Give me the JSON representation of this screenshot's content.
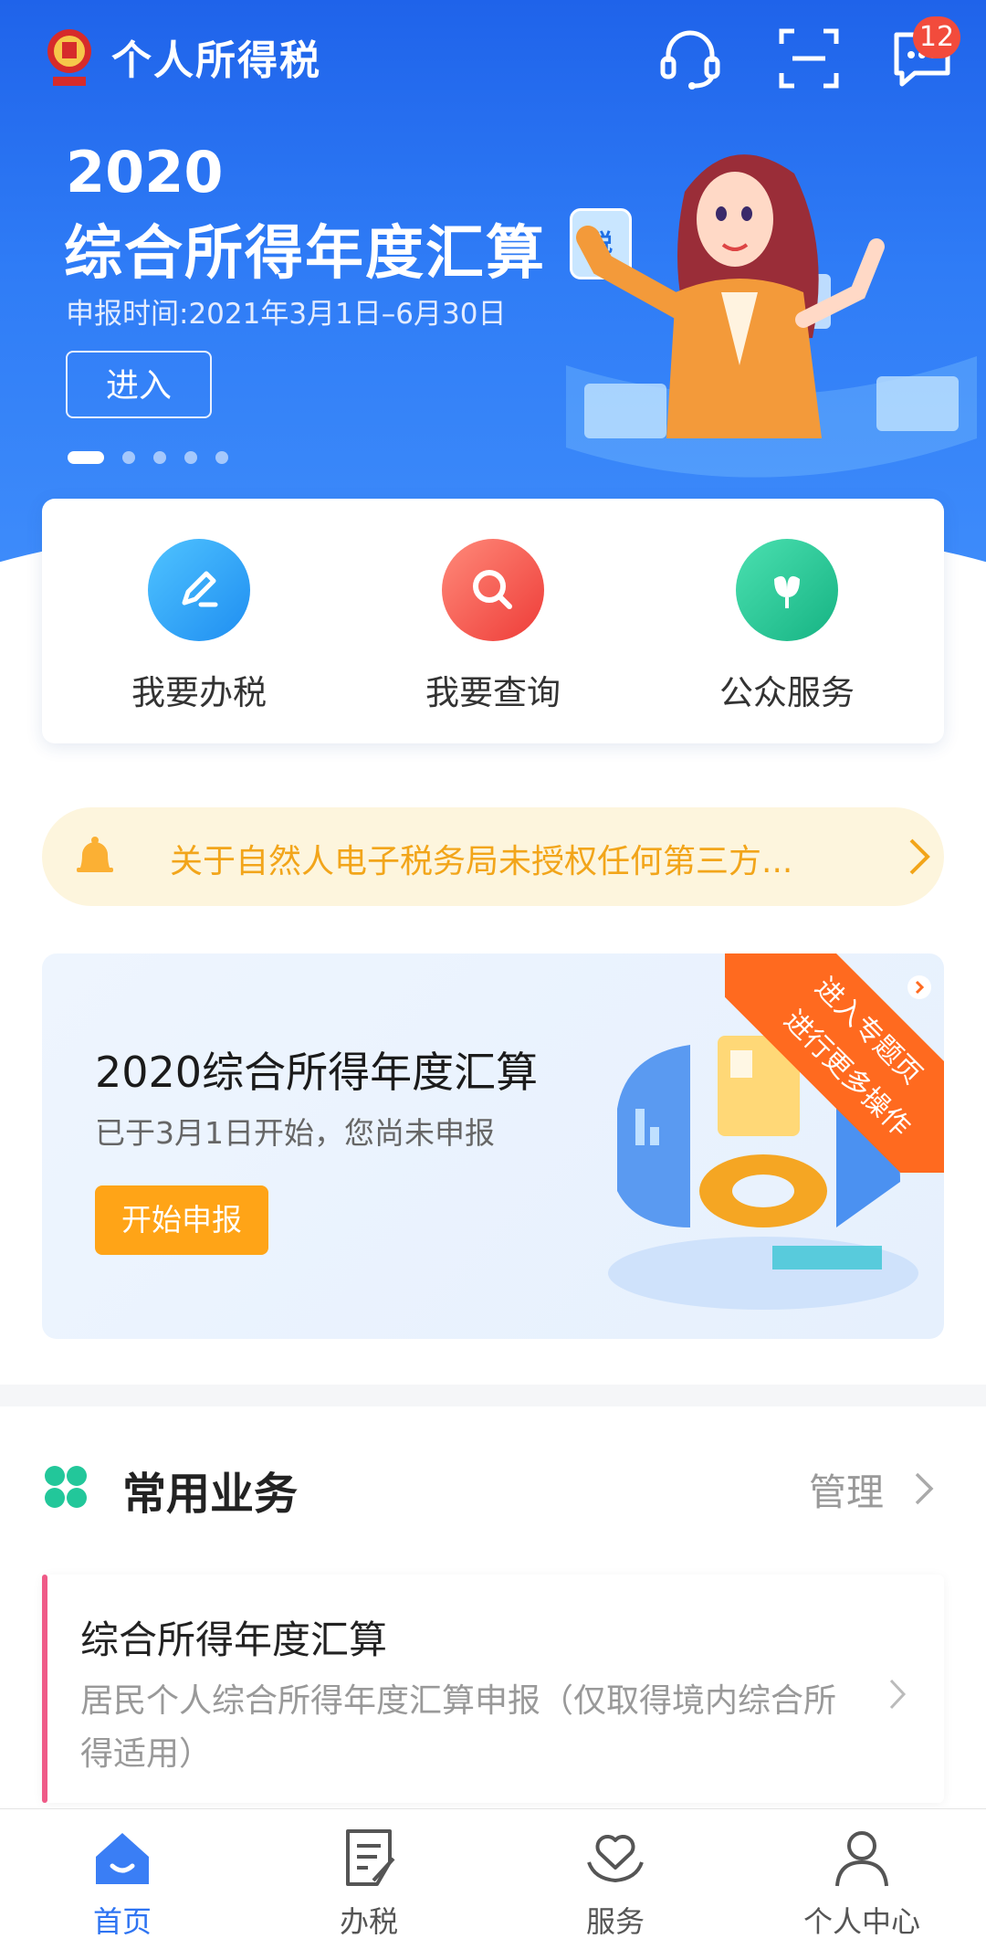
{
  "header": {
    "app_title": "个人所得税",
    "message_count": "12",
    "icons": [
      "customer-service-icon",
      "scan-icon",
      "message-icon"
    ]
  },
  "banner": {
    "year": "2020",
    "title": "综合所得年度汇算",
    "subtitle": "申报时间:2021年3月1日–6月30日",
    "enter_label": "进入",
    "tax_tag": "税",
    "slides": 5,
    "active_slide": 1
  },
  "quick_actions": [
    {
      "label": "我要办税",
      "icon": "edit-icon",
      "color": "#27a7f7"
    },
    {
      "label": "我要查询",
      "icon": "search-icon",
      "color": "#f2544a"
    },
    {
      "label": "公众服务",
      "icon": "tulip-icon",
      "color": "#22c28e"
    }
  ],
  "notice": {
    "text": "关于自然人电子税务局未授权任何第三方..."
  },
  "promo": {
    "title": "2020综合所得年度汇算",
    "subtitle": "已于3月1日开始，您尚未申报",
    "button_label": "开始申报",
    "ribbon_line1": "进入专题页",
    "ribbon_line2": "进行更多操作"
  },
  "common": {
    "title": "常用业务",
    "manage_label": "管理",
    "items": [
      {
        "title": "综合所得年度汇算",
        "description": "居民个人综合所得年度汇算申报（仅取得境内综合所得适用）"
      }
    ]
  },
  "tabs": [
    {
      "label": "首页",
      "icon": "home-icon",
      "active": true
    },
    {
      "label": "办税",
      "icon": "document-edit-icon",
      "active": false
    },
    {
      "label": "服务",
      "icon": "heart-hands-icon",
      "active": false
    },
    {
      "label": "个人中心",
      "icon": "user-icon",
      "active": false
    }
  ],
  "colors": {
    "brand_blue": "#2e74f2",
    "notice_text": "#f2a51a",
    "promo_button": "#ffa417",
    "ribbon": "#ff6a1f",
    "accent_pink": "#ef5a87"
  }
}
